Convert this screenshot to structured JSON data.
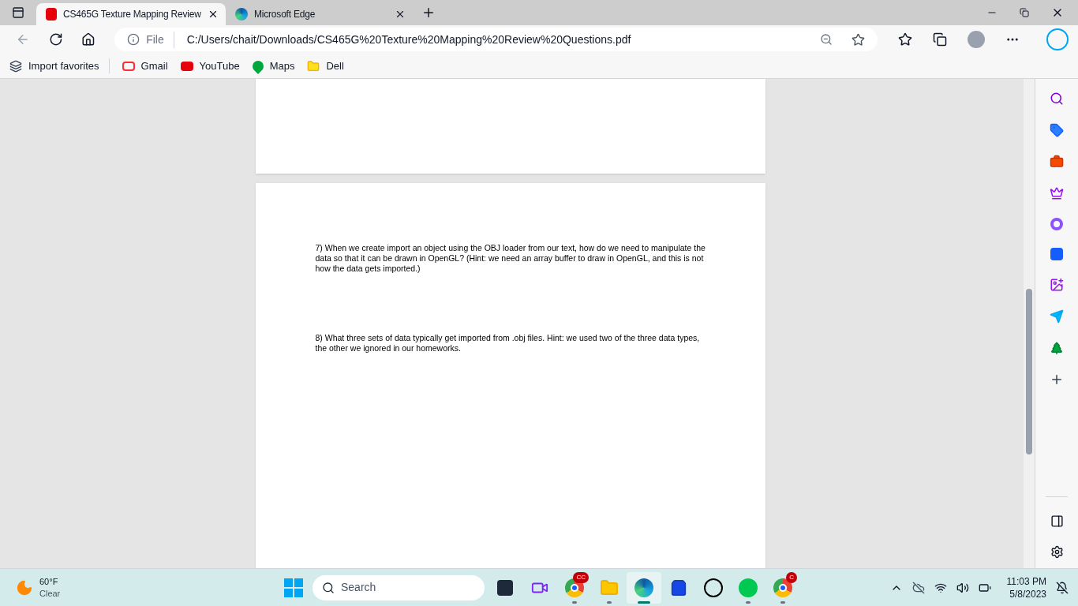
{
  "tabs": [
    {
      "kind": "pdf",
      "label": "CS465G Texture Mapping Review",
      "selected": true
    },
    {
      "kind": "edge",
      "label": "Microsoft Edge",
      "selected": false
    }
  ],
  "address": {
    "scheme": "File",
    "url": "C:/Users/chait/Downloads/CS465G%20Texture%20Mapping%20Review%20Questions.pdf"
  },
  "favorites": [
    {
      "kind": "import",
      "label": "Import favorites"
    },
    {
      "kind": "gmail",
      "label": "Gmail"
    },
    {
      "kind": "youtube",
      "label": "YouTube"
    },
    {
      "kind": "maps",
      "label": "Maps"
    },
    {
      "kind": "folder",
      "label": "Dell"
    }
  ],
  "document": {
    "paragraphs": [
      "7) When we create import an object using the OBJ loader from our text, how do we need to manipulate the data so that it can be drawn in OpenGL? (Hint: we need an array buffer to draw in OpenGL, and this is not how the data gets imported.)",
      "8) What three sets of data typically get imported from .obj files. Hint: we used two of the three data types, the other we ignored in our homeworks."
    ]
  },
  "taskbar": {
    "weather": {
      "temp": "60°F",
      "condition": "Clear"
    },
    "search": {
      "placeholder": "Search"
    },
    "apps": [
      {
        "kind": "taskview",
        "running": false,
        "selected": false
      },
      {
        "kind": "chat",
        "running": false,
        "selected": false
      },
      {
        "kind": "chrome",
        "running": true,
        "selected": false,
        "badge": "CC"
      },
      {
        "kind": "files",
        "running": true,
        "selected": false
      },
      {
        "kind": "edge",
        "running": true,
        "selected": true
      },
      {
        "kind": "store",
        "running": false,
        "selected": false
      },
      {
        "kind": "dell",
        "running": false,
        "selected": false
      },
      {
        "kind": "spotify",
        "running": true,
        "selected": false
      },
      {
        "kind": "chrome",
        "running": true,
        "selected": false,
        "badge": "C"
      }
    ],
    "time": "11:03 PM",
    "date": "5/8/2023"
  }
}
